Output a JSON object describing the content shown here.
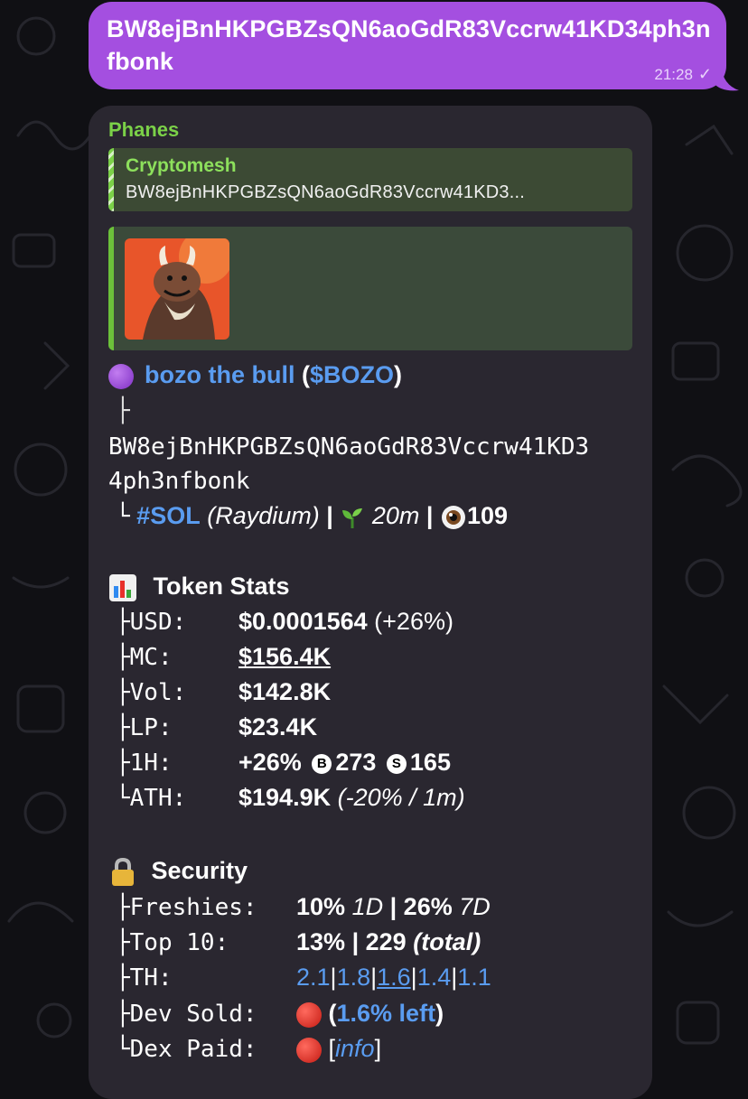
{
  "outgoing_message": {
    "text": "BW8ejBnHKPGBZsQN6aoGdR83Vccrw41KD34ph3nfbonk",
    "time": "21:28",
    "check": "✓"
  },
  "incoming_message": {
    "sender": "Phanes",
    "reply": {
      "name": "Cryptomesh",
      "text": "BW8ejBnHKPGBZsQN6aoGdR83Vccrw41KD3..."
    },
    "token": {
      "name": "bozo the bull",
      "ticker": "$BOZO",
      "tree_top": "├",
      "address_line1": "BW8ejBnHKPGBZsQN6aoGdR83Vccrw41KD3",
      "address_line2": "4ph3nfbonk",
      "tree_end": "└",
      "chain": "#SOL",
      "dex": "(Raydium)",
      "sep": "|",
      "age": "20m",
      "views": "109"
    },
    "stats": {
      "title": "Token Stats",
      "usd_label": "├USD:",
      "usd_value": "$0.0001564",
      "usd_change": "(+26%)",
      "mc_label": "├MC:",
      "mc_value": "$156.4K",
      "vol_label": "├Vol:",
      "vol_value": "$142.8K",
      "lp_label": "├LP:",
      "lp_value": "$23.4K",
      "h1_label": "├1H:",
      "h1_change": "+26%",
      "buy_icon": "B",
      "buys": "273",
      "sell_icon": "S",
      "sells": "165",
      "ath_label": "└ATH:",
      "ath_value": "$194.9K",
      "ath_note": "(-20% / 1m)"
    },
    "security": {
      "title": "Security",
      "freshies_label": "├Freshies:",
      "freshies_1d": "10%",
      "freshies_1d_unit": "1D",
      "sep": "|",
      "freshies_7d": "26%",
      "freshies_7d_unit": "7D",
      "top10_label": "├Top 10:",
      "top10_pct": "13%",
      "top10_total": "229",
      "top10_total_label": "(total)",
      "th_label": "├TH:",
      "th_values": [
        "2.1",
        "1.8",
        "1.6",
        "1.4",
        "1.1"
      ],
      "devsold_label": "├Dev Sold:",
      "devsold_open": "(",
      "devsold_value": "1.6% left",
      "devsold_close": ")",
      "dexpaid_label": "└Dex Paid:",
      "dexpaid_open": "[",
      "dexpaid_link": "info",
      "dexpaid_close": "]"
    }
  },
  "colors": {
    "outgoing_bubble": "#a44fe0",
    "incoming_bubble": "#2a2730",
    "sender_name": "#7bd148",
    "link": "#5a9cf0",
    "status_red": "#e8302a"
  }
}
